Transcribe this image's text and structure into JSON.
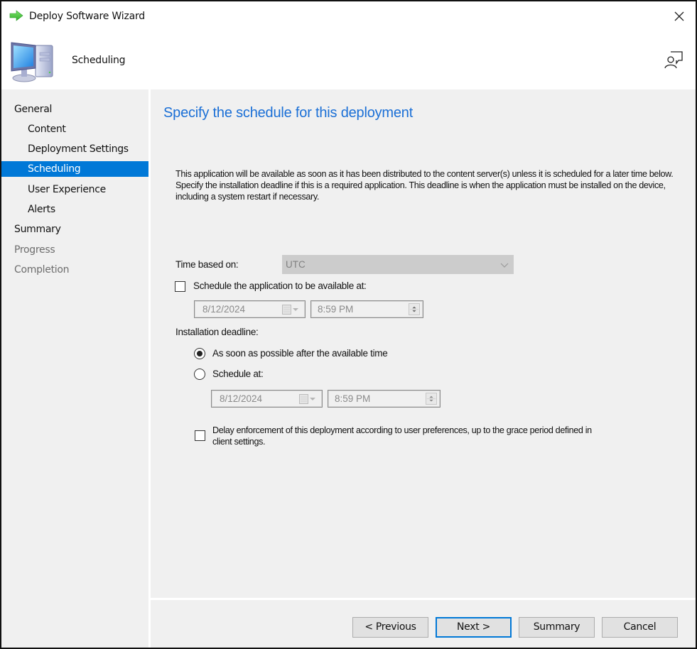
{
  "window": {
    "title": "Deploy Software Wizard",
    "title_icon": "green-arrow-icon",
    "close_icon": "close-icon"
  },
  "header": {
    "title": "Scheduling",
    "icon": "computer-icon",
    "feedback_icon": "feedback-icon"
  },
  "nav": {
    "items": [
      {
        "label": "General",
        "level": 0,
        "state": "normal"
      },
      {
        "label": "Content",
        "level": 1,
        "state": "normal"
      },
      {
        "label": "Deployment Settings",
        "level": 1,
        "state": "normal"
      },
      {
        "label": "Scheduling",
        "level": 1,
        "state": "selected"
      },
      {
        "label": "User Experience",
        "level": 1,
        "state": "normal"
      },
      {
        "label": "Alerts",
        "level": 1,
        "state": "normal"
      },
      {
        "label": "Summary",
        "level": 0,
        "state": "normal"
      },
      {
        "label": "Progress",
        "level": 0,
        "state": "disabled"
      },
      {
        "label": "Completion",
        "level": 0,
        "state": "disabled"
      }
    ]
  },
  "content": {
    "heading": "Specify the schedule for this deployment",
    "description": "This application will be available as soon as it has been distributed to the content server(s) unless it is scheduled for a later time below. Specify the installation deadline if this is a required application. This deadline is when the application must be installed on the device, including a system restart if necessary.",
    "time_based_on": {
      "label": "Time based on:",
      "value": "UTC",
      "enabled": false
    },
    "schedule_available": {
      "label": "Schedule the application to be available at:",
      "checked": false,
      "date": "8/12/2024",
      "time": "8:59 PM"
    },
    "installation_deadline": {
      "label": "Installation deadline:",
      "asap_label": "As soon as possible after the available time",
      "asap_selected": true,
      "schedule_label": "Schedule at:",
      "schedule_selected": false,
      "date": "8/12/2024",
      "time": "8:59 PM"
    },
    "delay_enforcement": {
      "label_line1": "Delay enforcement of this deployment according to user preferences, up to the grace period defined in",
      "label_line2": "client settings.",
      "checked": false
    }
  },
  "footer": {
    "previous_label": "< Previous",
    "next_label": "Next >",
    "summary_label": "Summary",
    "cancel_label": "Cancel"
  },
  "colors": {
    "accent": "#0078d7",
    "heading": "#1a6fd6",
    "panel_bg": "#f0f0f0",
    "disabled_text": "#6d6d6d"
  }
}
